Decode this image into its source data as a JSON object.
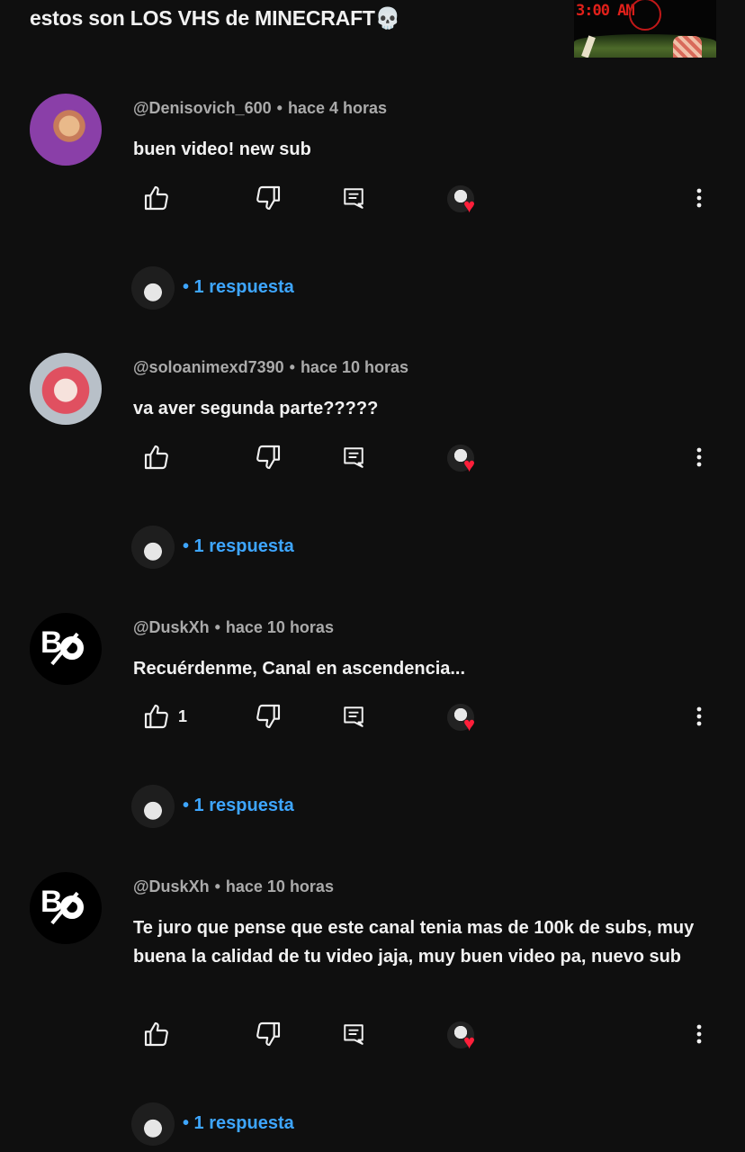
{
  "video": {
    "title": "estos son LOS VHS de MINECRAFT💀",
    "thumbnail_text": "3:00 AM"
  },
  "comments": [
    {
      "author": "@Denisovich_600",
      "time": "hace 4 horas",
      "text": "buen video! new sub",
      "likes": "",
      "replies_label": "• 1 respuesta",
      "avatar": "purple-character-avatar"
    },
    {
      "author": "@soloanimexd7390",
      "time": "hace 10 horas",
      "text": "va aver segunda parte?????",
      "likes": "",
      "replies_label": "• 1 respuesta",
      "avatar": "anime-girl-avatar"
    },
    {
      "author": "@DuskXh",
      "time": "hace 10 horas",
      "text": "Recuérdenme, Canal en ascendencia...",
      "likes": "1",
      "replies_label": "• 1 respuesta",
      "avatar": "bo-logo-avatar"
    },
    {
      "author": "@DuskXh",
      "time": "hace 10 horas",
      "text": "Te juro que pense que este canal tenia mas de 100k de subs, muy buena la calidad de tu video jaja, muy buen video pa, nuevo sub",
      "likes": "",
      "replies_label": "• 1 respuesta",
      "avatar": "bo-logo-avatar"
    }
  ],
  "icons": {
    "like": "thumbs-up-icon",
    "dislike": "thumbs-down-icon",
    "reply": "reply-comment-icon",
    "creator_heart": "creator-heart-icon",
    "more": "more-vertical-icon"
  },
  "colors": {
    "background": "#0f0f0f",
    "text": "#f1f1f1",
    "meta": "#aaaaaa",
    "link": "#3ea6ff",
    "heart": "#ff1f3a"
  }
}
